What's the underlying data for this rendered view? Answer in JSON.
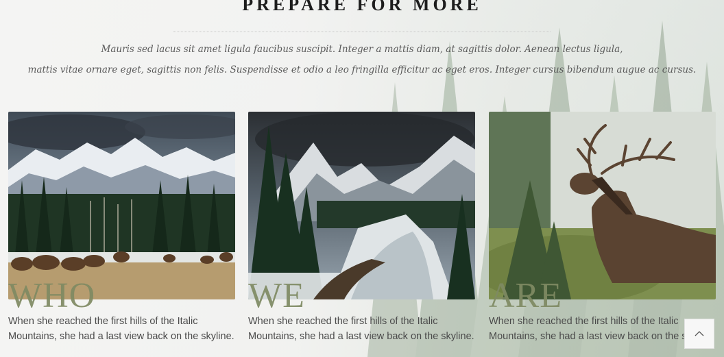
{
  "section": {
    "heading": "PREPARE FOR MORE",
    "intro_line1": "Mauris sed lacus sit amet ligula faucibus suscipit. Integer a mattis diam, at sagittis dolor. Aenean lectus ligula,",
    "intro_line2": "mattis vitae ornare eget, sagittis non felis. Suspendisse et odio a leo fringilla efficitur ac eget eros. Integer cursus bibendum augue ac cursus."
  },
  "cards": [
    {
      "word": "WHO",
      "desc_line1": "When she reached the first hills of the Italic",
      "desc_line2": "Mountains, she had a last view back on the skyline."
    },
    {
      "word": "WE",
      "desc_line1": "When she reached the first hills of the Italic",
      "desc_line2": "Mountains, she had a last view back on the skyline."
    },
    {
      "word": "ARE",
      "desc_line1": "When she reached the first hills of the Italic",
      "desc_line2": "Mountains, she had a last view back on the skyline."
    }
  ],
  "icons": {
    "scroll_top": "chevron-up-icon",
    "accent": "#7f8a63"
  }
}
